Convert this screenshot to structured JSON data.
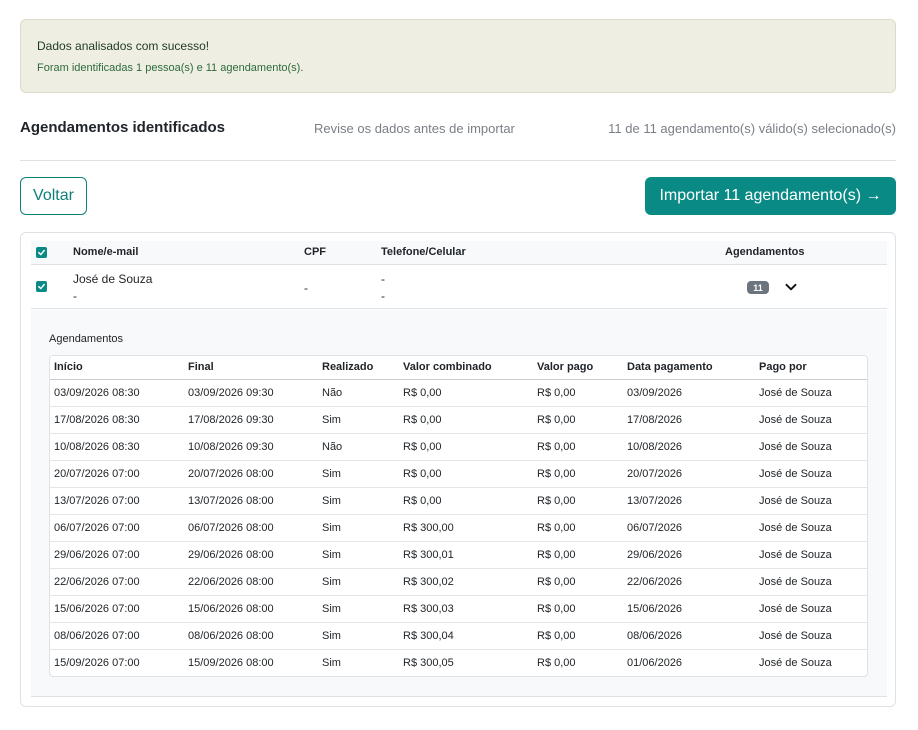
{
  "alert": {
    "title": "Dados analisados com sucesso!",
    "message": "Foram identificadas 1 pessoa(s) e 11 agendamento(s)."
  },
  "section": {
    "title": "Agendamentos identificados",
    "hint": "Revise os dados antes de importar",
    "selection_count": "11 de 11 agendamento(s) válido(s) selecionado(s)"
  },
  "actions": {
    "back_label": "Voltar",
    "import_label": "Importar 11 agendamento(s) →"
  },
  "table": {
    "columns": {
      "name": "Nome/e-mail",
      "cpf": "CPF",
      "phone": "Telefone/Celular",
      "appointments": "Agendamentos"
    },
    "person": {
      "name": "José de Souza",
      "email": "-",
      "cpf": "-",
      "phone": "-",
      "cellphone": "-",
      "appointments_count": "11"
    }
  },
  "appointments": {
    "title": "Agendamentos",
    "columns": [
      "Início",
      "Final",
      "Realizado",
      "Valor combinado",
      "Valor pago",
      "Data pagamento",
      "Pago por"
    ],
    "rows": [
      [
        "03/09/2026 08:30",
        "03/09/2026 09:30",
        "Não",
        "R$ 0,00",
        "R$ 0,00",
        "03/09/2026",
        "José de Souza"
      ],
      [
        "17/08/2026 08:30",
        "17/08/2026 09:30",
        "Sim",
        "R$ 0,00",
        "R$ 0,00",
        "17/08/2026",
        "José de Souza"
      ],
      [
        "10/08/2026 08:30",
        "10/08/2026 09:30",
        "Não",
        "R$ 0,00",
        "R$ 0,00",
        "10/08/2026",
        "José de Souza"
      ],
      [
        "20/07/2026 07:00",
        "20/07/2026 08:00",
        "Sim",
        "R$ 0,00",
        "R$ 0,00",
        "20/07/2026",
        "José de Souza"
      ],
      [
        "13/07/2026 07:00",
        "13/07/2026 08:00",
        "Sim",
        "R$ 0,00",
        "R$ 0,00",
        "13/07/2026",
        "José de Souza"
      ],
      [
        "06/07/2026 07:00",
        "06/07/2026 08:00",
        "Sim",
        "R$ 300,00",
        "R$ 0,00",
        "06/07/2026",
        "José de Souza"
      ],
      [
        "29/06/2026 07:00",
        "29/06/2026 08:00",
        "Sim",
        "R$ 300,01",
        "R$ 0,00",
        "29/06/2026",
        "José de Souza"
      ],
      [
        "22/06/2026 07:00",
        "22/06/2026 08:00",
        "Sim",
        "R$ 300,02",
        "R$ 0,00",
        "22/06/2026",
        "José de Souza"
      ],
      [
        "15/06/2026 07:00",
        "15/06/2026 08:00",
        "Sim",
        "R$ 300,03",
        "R$ 0,00",
        "15/06/2026",
        "José de Souza"
      ],
      [
        "08/06/2026 07:00",
        "08/06/2026 08:00",
        "Sim",
        "R$ 300,04",
        "R$ 0,00",
        "08/06/2026",
        "José de Souza"
      ],
      [
        "15/09/2026 07:00",
        "15/09/2026 08:00",
        "Sim",
        "R$ 300,05",
        "R$ 0,00",
        "01/06/2026",
        "José de Souza"
      ]
    ]
  },
  "icons": {
    "checkbox": "check-icon",
    "expand": "chevron-down-icon"
  },
  "colors": {
    "accent": "#0a8a85",
    "alert_bg": "#efeee3",
    "badge": "#6c757d"
  }
}
